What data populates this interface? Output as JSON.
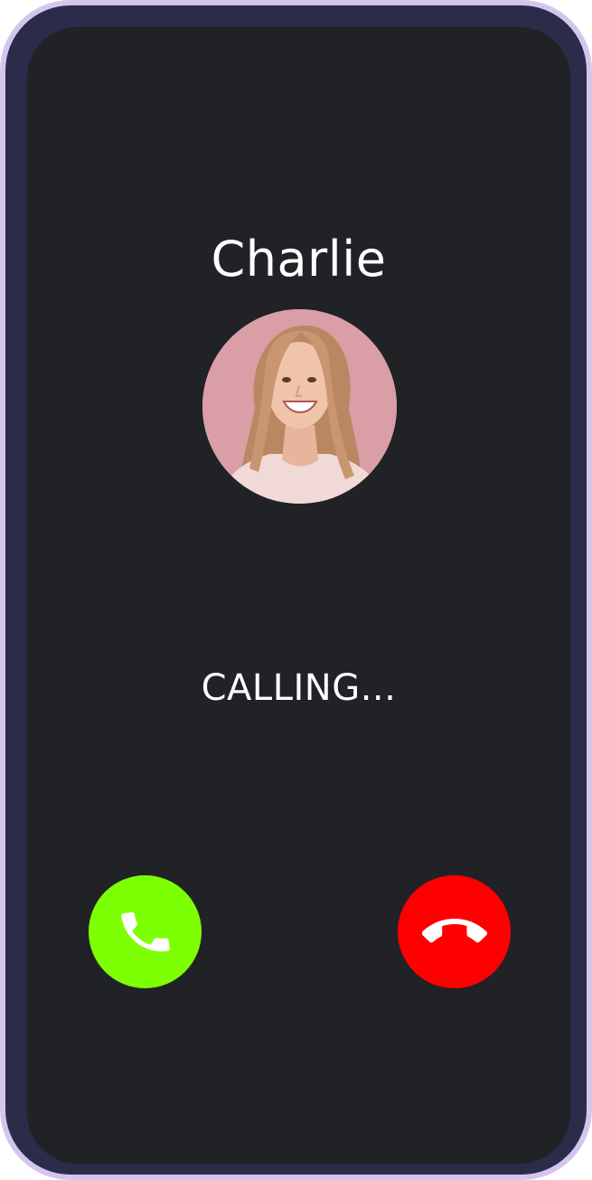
{
  "call": {
    "caller_name": "Charlie",
    "status": "CALLING..."
  },
  "avatar": {
    "icon": "caller-photo"
  },
  "actions": {
    "accept": {
      "icon": "phone-icon",
      "color": "#7dff04"
    },
    "decline": {
      "icon": "phone-hangup-icon",
      "color": "#ff0000"
    }
  },
  "theme": {
    "frame_outer": "#d4c5ee",
    "frame_inner": "#2b2c4a",
    "screen": "#202226",
    "text": "#ffffff"
  }
}
